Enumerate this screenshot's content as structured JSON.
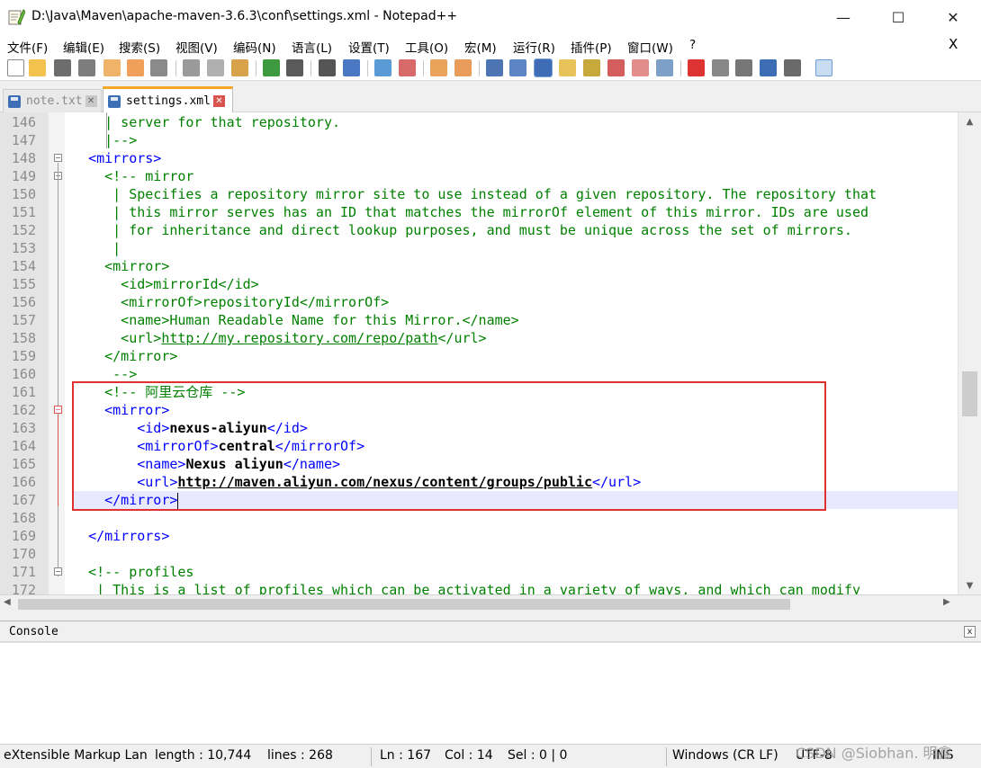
{
  "window": {
    "title": "D:\\Java\\Maven\\apache-maven-3.6.3\\conf\\settings.xml - Notepad++",
    "minimize": "—",
    "maximize": "☐",
    "close": "✕"
  },
  "menu": {
    "items": [
      "文件(F)",
      "编辑(E)",
      "搜索(S)",
      "视图(V)",
      "编码(N)",
      "语言(L)",
      "设置(T)",
      "工具(O)",
      "宏(M)",
      "运行(R)",
      "插件(P)",
      "窗口(W)",
      "?"
    ],
    "close_doc": "X"
  },
  "toolbar": {
    "icons": [
      "new-file",
      "open-file",
      "save",
      "save-all",
      "close",
      "close-all",
      "print",
      "cut",
      "copy",
      "paste",
      "undo",
      "redo",
      "find",
      "replace",
      "zoom-in",
      "zoom-out",
      "sync-vertical",
      "sync-horizontal",
      "word-wrap",
      "show-all-chars",
      "indent-guide",
      "doc-map",
      "function-list",
      "folder-workspace",
      "monitor",
      "record-macro",
      "stop-macro",
      "play-macro",
      "run-macro-multiple",
      "save-macro",
      "console"
    ]
  },
  "tabs": [
    {
      "label": "note.txt",
      "active": false
    },
    {
      "label": "settings.xml",
      "active": true
    }
  ],
  "editor": {
    "lines": [
      {
        "n": "146",
        "segs": [
          {
            "t": "    | server for that repository.",
            "c": "cmt"
          }
        ]
      },
      {
        "n": "147",
        "segs": [
          {
            "t": "    |-->",
            "c": "cmt"
          }
        ]
      },
      {
        "n": "148",
        "segs": [
          {
            "t": "  ",
            "c": ""
          },
          {
            "t": "<mirrors>",
            "c": "tag"
          }
        ]
      },
      {
        "n": "149",
        "segs": [
          {
            "t": "    <!-- mirror",
            "c": "cmt"
          }
        ]
      },
      {
        "n": "150",
        "segs": [
          {
            "t": "     | Specifies a repository mirror site to use instead of a given repository. The repository that",
            "c": "cmt"
          }
        ]
      },
      {
        "n": "151",
        "segs": [
          {
            "t": "     | this mirror serves has an ID that matches the mirrorOf element of this mirror. IDs are used",
            "c": "cmt"
          }
        ]
      },
      {
        "n": "152",
        "segs": [
          {
            "t": "     | for inheritance and direct lookup purposes, and must be unique across the set of mirrors.",
            "c": "cmt"
          }
        ]
      },
      {
        "n": "153",
        "segs": [
          {
            "t": "     |",
            "c": "cmt"
          }
        ]
      },
      {
        "n": "154",
        "segs": [
          {
            "t": "    <mirror>",
            "c": "cmt"
          }
        ]
      },
      {
        "n": "155",
        "segs": [
          {
            "t": "      <id>mirrorId</id>",
            "c": "cmt"
          }
        ]
      },
      {
        "n": "156",
        "segs": [
          {
            "t": "      <mirrorOf>repositoryId</mirrorOf>",
            "c": "cmt"
          }
        ]
      },
      {
        "n": "157",
        "segs": [
          {
            "t": "      <name>Human Readable Name for this Mirror.</name>",
            "c": "cmt"
          }
        ]
      },
      {
        "n": "158",
        "segs": [
          {
            "t": "      <url>",
            "c": "cmt"
          },
          {
            "t": "http://my.repository.com/repo/path",
            "c": "url"
          },
          {
            "t": "</url>",
            "c": "cmt"
          }
        ]
      },
      {
        "n": "159",
        "segs": [
          {
            "t": "    </mirror>",
            "c": "cmt"
          }
        ]
      },
      {
        "n": "160",
        "segs": [
          {
            "t": "     -->",
            "c": "cmt"
          }
        ]
      },
      {
        "n": "161",
        "segs": [
          {
            "t": "    <!-- 阿里云仓库 -->",
            "c": "cmt"
          }
        ]
      },
      {
        "n": "162",
        "segs": [
          {
            "t": "    ",
            "c": ""
          },
          {
            "t": "<mirror>",
            "c": "tag"
          }
        ]
      },
      {
        "n": "163",
        "segs": [
          {
            "t": "        ",
            "c": ""
          },
          {
            "t": "<id>",
            "c": "tag"
          },
          {
            "t": "nexus-aliyun",
            "c": "bold"
          },
          {
            "t": "</id>",
            "c": "tag"
          }
        ]
      },
      {
        "n": "164",
        "segs": [
          {
            "t": "        ",
            "c": ""
          },
          {
            "t": "<mirrorOf>",
            "c": "tag"
          },
          {
            "t": "central",
            "c": "bold"
          },
          {
            "t": "</mirrorOf>",
            "c": "tag"
          }
        ]
      },
      {
        "n": "165",
        "segs": [
          {
            "t": "        ",
            "c": ""
          },
          {
            "t": "<name>",
            "c": "tag"
          },
          {
            "t": "Nexus aliyun",
            "c": "bold"
          },
          {
            "t": "</name>",
            "c": "tag"
          }
        ]
      },
      {
        "n": "166",
        "segs": [
          {
            "t": "        ",
            "c": ""
          },
          {
            "t": "<url>",
            "c": "tag"
          },
          {
            "t": "http://maven.aliyun.com/nexus/content/groups/public",
            "c": "bold url-b"
          },
          {
            "t": "</url>",
            "c": "tag"
          }
        ]
      },
      {
        "n": "167",
        "segs": [
          {
            "t": "    ",
            "c": ""
          },
          {
            "t": "</mirror>",
            "c": "tag"
          }
        ]
      },
      {
        "n": "168",
        "segs": [
          {
            "t": "",
            "c": ""
          }
        ]
      },
      {
        "n": "169",
        "segs": [
          {
            "t": "  ",
            "c": ""
          },
          {
            "t": "</mirrors>",
            "c": "tag"
          }
        ]
      },
      {
        "n": "170",
        "segs": [
          {
            "t": "",
            "c": ""
          }
        ]
      },
      {
        "n": "171",
        "segs": [
          {
            "t": "  <!-- profiles",
            "c": "cmt"
          }
        ]
      },
      {
        "n": "172",
        "segs": [
          {
            "t": "   | This is a list of profiles which can be activated in a variety of ways, and which can modify",
            "c": "cmt"
          }
        ]
      }
    ],
    "current_line": "167"
  },
  "console": {
    "title": "Console",
    "close": "x"
  },
  "statusbar": {
    "language": "eXtensible Markup Lan",
    "length": "length : 10,744",
    "lines": "lines : 268",
    "ln": "Ln : 167",
    "col": "Col : 14",
    "sel": "Sel : 0 | 0",
    "eol": "Windows (CR LF)",
    "encoding": "UTF-8",
    "mode": "INS"
  },
  "watermark": "CSDN @Siobhan. 明鑫",
  "colors": {
    "comment": "#008000",
    "tag": "#0000ff",
    "highlight_box": "#e03131",
    "active_tab_accent": "#f5a623"
  }
}
